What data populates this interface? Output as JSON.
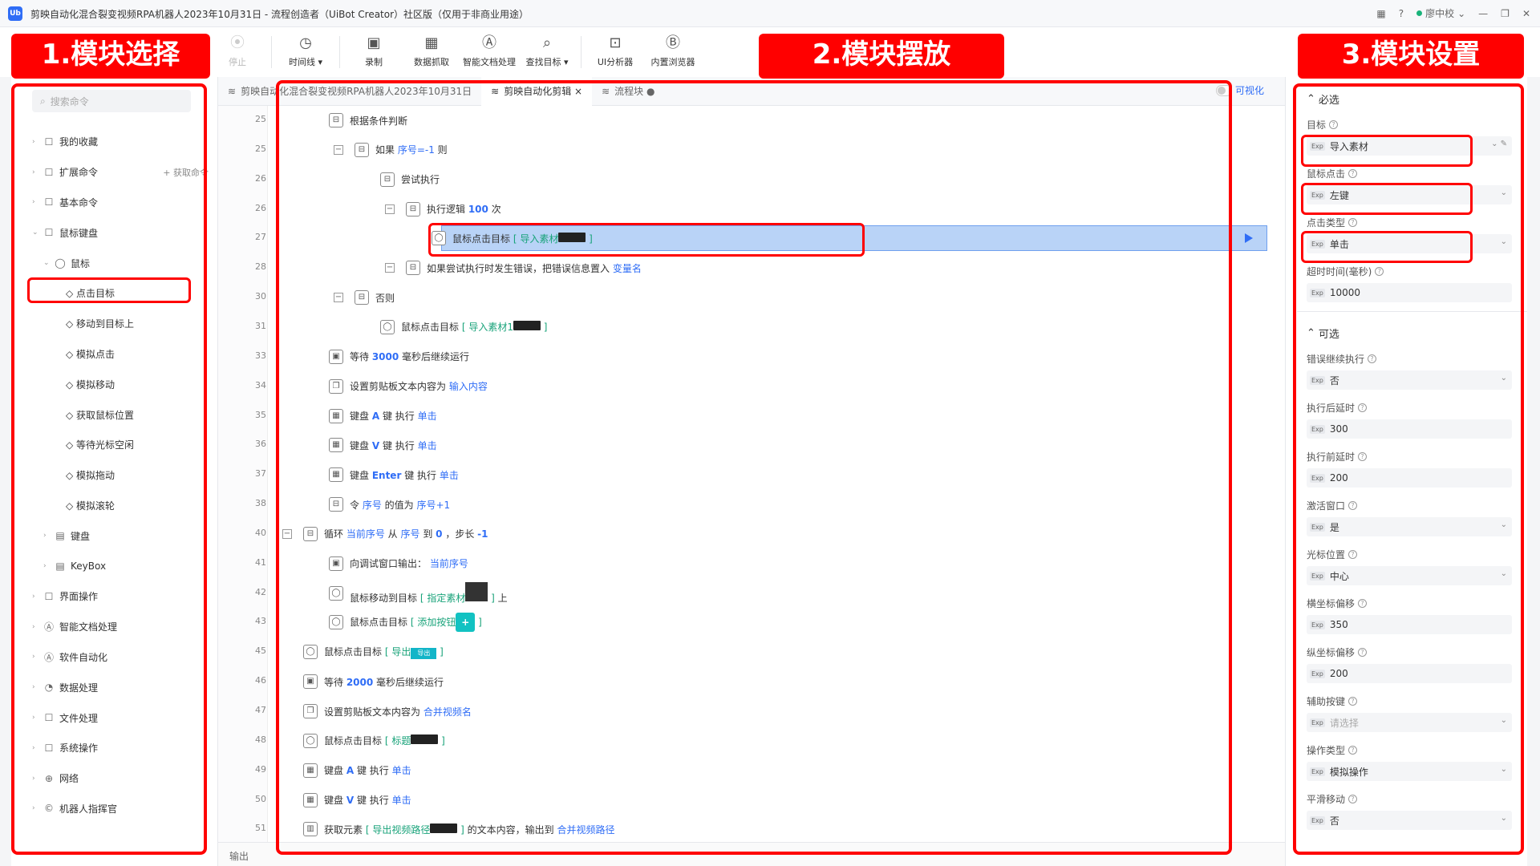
{
  "window": {
    "title": "剪映自动化混合裂变视频RPA机器人2023年10月31日 - 流程创造者（UiBot Creator）社区版（仅用于非商业用途）",
    "logo": "Ub",
    "user": "廖中校"
  },
  "toolbar": {
    "items": [
      {
        "label": "停止",
        "icon": "stop-icon",
        "glyph": "⦿",
        "disabled": true
      },
      {
        "label": "时间线 ▾",
        "icon": "clock-icon",
        "glyph": "◷"
      },
      {
        "label": "录制",
        "icon": "record-icon",
        "glyph": "▣"
      },
      {
        "label": "数据抓取",
        "icon": "data-scrape-icon",
        "glyph": "▦"
      },
      {
        "label": "智能文档处理",
        "icon": "ai-doc-icon",
        "glyph": "Ⓐ"
      },
      {
        "label": "查找目标 ▾",
        "icon": "find-target-icon",
        "glyph": "⌕"
      },
      {
        "label": "UI分析器",
        "icon": "ui-analyzer-icon",
        "glyph": "⊡"
      },
      {
        "label": "内置浏览器",
        "icon": "browser-icon",
        "glyph": "Ⓑ"
      }
    ]
  },
  "annotations": {
    "a1": "1.模块选择",
    "a2": "2.模块摆放",
    "a3": "3.模块设置"
  },
  "left": {
    "search_placeholder": "搜索命令",
    "tree": [
      {
        "label": "我的收藏",
        "indent": 0,
        "arrow": "›",
        "icon": "☐"
      },
      {
        "label": "扩展命令",
        "indent": 0,
        "arrow": "›",
        "icon": "☐",
        "extra": "+ 获取命令"
      },
      {
        "label": "基本命令",
        "indent": 0,
        "arrow": "›",
        "icon": "☐"
      },
      {
        "label": "鼠标键盘",
        "indent": 0,
        "arrow": "⌄",
        "icon": "☐"
      },
      {
        "label": "鼠标",
        "indent": 1,
        "arrow": "⌄",
        "icon": "◯"
      },
      {
        "label": "◇ 点击目标",
        "indent": 2,
        "arrow": "",
        "icon": ""
      },
      {
        "label": "◇ 移动到目标上",
        "indent": 2,
        "arrow": "",
        "icon": ""
      },
      {
        "label": "◇ 模拟点击",
        "indent": 2,
        "arrow": "",
        "icon": ""
      },
      {
        "label": "◇ 模拟移动",
        "indent": 2,
        "arrow": "",
        "icon": ""
      },
      {
        "label": "◇ 获取鼠标位置",
        "indent": 2,
        "arrow": "",
        "icon": ""
      },
      {
        "label": "◇ 等待光标空闲",
        "indent": 2,
        "arrow": "",
        "icon": ""
      },
      {
        "label": "◇ 模拟拖动",
        "indent": 2,
        "arrow": "",
        "icon": ""
      },
      {
        "label": "◇ 模拟滚轮",
        "indent": 2,
        "arrow": "",
        "icon": ""
      },
      {
        "label": "键盘",
        "indent": 1,
        "arrow": "›",
        "icon": "▤"
      },
      {
        "label": "KeyBox",
        "indent": 1,
        "arrow": "›",
        "icon": "▤"
      },
      {
        "label": "界面操作",
        "indent": 0,
        "arrow": "›",
        "icon": "☐"
      },
      {
        "label": "智能文档处理",
        "indent": 0,
        "arrow": "›",
        "icon": "Ⓐ"
      },
      {
        "label": "软件自动化",
        "indent": 0,
        "arrow": "›",
        "icon": "Ⓐ"
      },
      {
        "label": "数据处理",
        "indent": 0,
        "arrow": "›",
        "icon": "◔"
      },
      {
        "label": "文件处理",
        "indent": 0,
        "arrow": "›",
        "icon": "☐"
      },
      {
        "label": "系统操作",
        "indent": 0,
        "arrow": "›",
        "icon": "☐"
      },
      {
        "label": "网络",
        "indent": 0,
        "arrow": "›",
        "icon": "⊕"
      },
      {
        "label": "机器人指挥官",
        "indent": 0,
        "arrow": "›",
        "icon": "©"
      }
    ]
  },
  "main": {
    "tabs": [
      {
        "label": "剪映自动化混合裂变视频RPA机器人2023年10月31日",
        "active": false
      },
      {
        "label": "剪映自动化剪辑 ×",
        "active": true
      },
      {
        "label": "流程块 ●",
        "active": false
      }
    ],
    "visual_toggle": "可视化",
    "output_label": "输出",
    "rows": [
      {
        "ln": "25",
        "indent": 1,
        "collapse": false,
        "icon": "⊟",
        "parts": [
          [
            "t",
            "根据条件判断"
          ]
        ]
      },
      {
        "ln": "25",
        "indent": 2,
        "collapse": true,
        "icon": "⊟",
        "parts": [
          [
            "t",
            "如果 "
          ],
          [
            "v",
            "序号=-1"
          ],
          [
            "t",
            " 则"
          ]
        ]
      },
      {
        "ln": "26",
        "indent": 3,
        "collapse": false,
        "icon": "⊟",
        "parts": [
          [
            "t",
            "尝试执行"
          ]
        ]
      },
      {
        "ln": "26",
        "indent": 4,
        "collapse": true,
        "icon": "⊟",
        "parts": [
          [
            "t",
            "执行逻辑 "
          ],
          [
            "k",
            "100"
          ],
          [
            "t",
            " 次"
          ]
        ]
      },
      {
        "ln": "27",
        "indent": 5,
        "collapse": false,
        "icon": "◯",
        "selected": true,
        "parts": [
          [
            "t",
            "鼠标点击目标 "
          ],
          [
            "g",
            "[ 导入素材"
          ],
          [
            "th",
            ""
          ],
          [
            "g",
            " ]"
          ]
        ]
      },
      {
        "ln": "28",
        "indent": 4,
        "collapse": true,
        "icon": "⊟",
        "parts": [
          [
            "t",
            "如果尝试执行时发生错误，把错误信息置入 "
          ],
          [
            "v",
            "变量名"
          ]
        ]
      },
      {
        "ln": "30",
        "indent": 2,
        "collapse": true,
        "icon": "⊟",
        "parts": [
          [
            "t",
            "否则"
          ]
        ]
      },
      {
        "ln": "31",
        "indent": 3,
        "collapse": false,
        "icon": "◯",
        "parts": [
          [
            "t",
            "鼠标点击目标 "
          ],
          [
            "g",
            "[ 导入素材1"
          ],
          [
            "th",
            ""
          ],
          [
            "g",
            " ]"
          ]
        ]
      },
      {
        "ln": "33",
        "indent": 1,
        "collapse": false,
        "icon": "▣",
        "parts": [
          [
            "t",
            "等待 "
          ],
          [
            "k",
            "3000"
          ],
          [
            "t",
            " 毫秒后继续运行"
          ]
        ]
      },
      {
        "ln": "34",
        "indent": 1,
        "collapse": false,
        "icon": "❐",
        "parts": [
          [
            "t",
            "设置剪贴板文本内容为 "
          ],
          [
            "v",
            "输入内容"
          ]
        ]
      },
      {
        "ln": "35",
        "indent": 1,
        "collapse": false,
        "icon": "▦",
        "parts": [
          [
            "t",
            "键盘 "
          ],
          [
            "k",
            "A"
          ],
          [
            "t",
            " 键 执行 "
          ],
          [
            "v",
            "单击"
          ]
        ]
      },
      {
        "ln": "36",
        "indent": 1,
        "collapse": false,
        "icon": "▦",
        "parts": [
          [
            "t",
            "键盘 "
          ],
          [
            "k",
            "V"
          ],
          [
            "t",
            " 键 执行 "
          ],
          [
            "v",
            "单击"
          ]
        ]
      },
      {
        "ln": "37",
        "indent": 1,
        "collapse": false,
        "icon": "▦",
        "parts": [
          [
            "t",
            "键盘 "
          ],
          [
            "k",
            "Enter"
          ],
          [
            "t",
            " 键 执行 "
          ],
          [
            "v",
            "单击"
          ]
        ]
      },
      {
        "ln": "38",
        "indent": 1,
        "collapse": false,
        "icon": "⊟",
        "parts": [
          [
            "t",
            "令 "
          ],
          [
            "v",
            "序号"
          ],
          [
            "t",
            " 的值为 "
          ],
          [
            "v",
            "序号+1"
          ]
        ]
      },
      {
        "ln": "40",
        "indent": 0,
        "collapse": true,
        "icon": "⊟",
        "parts": [
          [
            "t",
            "循环 "
          ],
          [
            "v",
            "当前序号"
          ],
          [
            "t",
            " 从 "
          ],
          [
            "v",
            "序号"
          ],
          [
            "t",
            " 到 "
          ],
          [
            "k",
            "0"
          ],
          [
            "t",
            " ，步长 "
          ],
          [
            "k",
            "-1"
          ]
        ]
      },
      {
        "ln": "41",
        "indent": 1,
        "collapse": false,
        "icon": "▣",
        "parts": [
          [
            "t",
            "向调试窗口输出： "
          ],
          [
            "v",
            "当前序号"
          ]
        ]
      },
      {
        "ln": "42",
        "indent": 1,
        "collapse": false,
        "icon": "◯",
        "parts": [
          [
            "t",
            "鼠标移动到目标 "
          ],
          [
            "g",
            "[ 指定素材"
          ],
          [
            "sq",
            ""
          ],
          [
            "g",
            " ]"
          ],
          [
            "t",
            " 上"
          ]
        ]
      },
      {
        "ln": "43",
        "indent": 1,
        "collapse": false,
        "icon": "◯",
        "parts": [
          [
            "t",
            "鼠标点击目标 "
          ],
          [
            "g",
            "[ 添加按钮"
          ],
          [
            "plus",
            "+"
          ],
          [
            "g",
            " ]"
          ]
        ]
      },
      {
        "ln": "45",
        "indent": 0,
        "collapse": false,
        "icon": "◯",
        "parts": [
          [
            "t",
            "鼠标点击目标 "
          ],
          [
            "g",
            "[ 导出"
          ],
          [
            "btn",
            "导出"
          ],
          [
            "g",
            " ]"
          ]
        ]
      },
      {
        "ln": "46",
        "indent": 0,
        "collapse": false,
        "icon": "▣",
        "parts": [
          [
            "t",
            "等待 "
          ],
          [
            "k",
            "2000"
          ],
          [
            "t",
            " 毫秒后继续运行"
          ]
        ]
      },
      {
        "ln": "47",
        "indent": 0,
        "collapse": false,
        "icon": "❐",
        "parts": [
          [
            "t",
            "设置剪贴板文本内容为 "
          ],
          [
            "v",
            "合并视频名"
          ]
        ]
      },
      {
        "ln": "48",
        "indent": 0,
        "collapse": false,
        "icon": "◯",
        "parts": [
          [
            "t",
            "鼠标点击目标 "
          ],
          [
            "g",
            "[ 标题"
          ],
          [
            "th",
            ""
          ],
          [
            "g",
            " ]"
          ]
        ]
      },
      {
        "ln": "49",
        "indent": 0,
        "collapse": false,
        "icon": "▦",
        "parts": [
          [
            "t",
            "键盘 "
          ],
          [
            "k",
            "A"
          ],
          [
            "t",
            " 键 执行 "
          ],
          [
            "v",
            "单击"
          ]
        ]
      },
      {
        "ln": "50",
        "indent": 0,
        "collapse": false,
        "icon": "▦",
        "parts": [
          [
            "t",
            "键盘 "
          ],
          [
            "k",
            "V"
          ],
          [
            "t",
            " 键 执行 "
          ],
          [
            "v",
            "单击"
          ]
        ]
      },
      {
        "ln": "51",
        "indent": 0,
        "collapse": false,
        "icon": "▥",
        "parts": [
          [
            "t",
            "获取元素 "
          ],
          [
            "g",
            "[ 导出视频路径"
          ],
          [
            "th",
            ""
          ],
          [
            "g",
            " ]"
          ],
          [
            "t",
            " 的文本内容，输出到 "
          ],
          [
            "v",
            "合并视频路径"
          ]
        ]
      }
    ]
  },
  "right": {
    "required_title": "必选",
    "optional_title": "可选",
    "required": [
      {
        "label": "目标",
        "value": "导入素材",
        "type": "target"
      },
      {
        "label": "鼠标点击",
        "value": "左键",
        "type": "select"
      },
      {
        "label": "点击类型",
        "value": "单击",
        "type": "select"
      },
      {
        "label": "超时时间(毫秒)",
        "value": "10000",
        "type": "text"
      }
    ],
    "optional": [
      {
        "label": "错误继续执行",
        "value": "否",
        "type": "select"
      },
      {
        "label": "执行后延时",
        "value": "300",
        "type": "text"
      },
      {
        "label": "执行前延时",
        "value": "200",
        "type": "text"
      },
      {
        "label": "激活窗口",
        "value": "是",
        "type": "select"
      },
      {
        "label": "光标位置",
        "value": "中心",
        "type": "select"
      },
      {
        "label": "横坐标偏移",
        "value": "350",
        "type": "text"
      },
      {
        "label": "纵坐标偏移",
        "value": "200",
        "type": "text"
      },
      {
        "label": "辅助按键",
        "value": "",
        "placeholder": "请选择",
        "type": "select"
      },
      {
        "label": "操作类型",
        "value": "模拟操作",
        "type": "select"
      },
      {
        "label": "平滑移动",
        "value": "否",
        "type": "select"
      }
    ],
    "exp": "Exp"
  }
}
